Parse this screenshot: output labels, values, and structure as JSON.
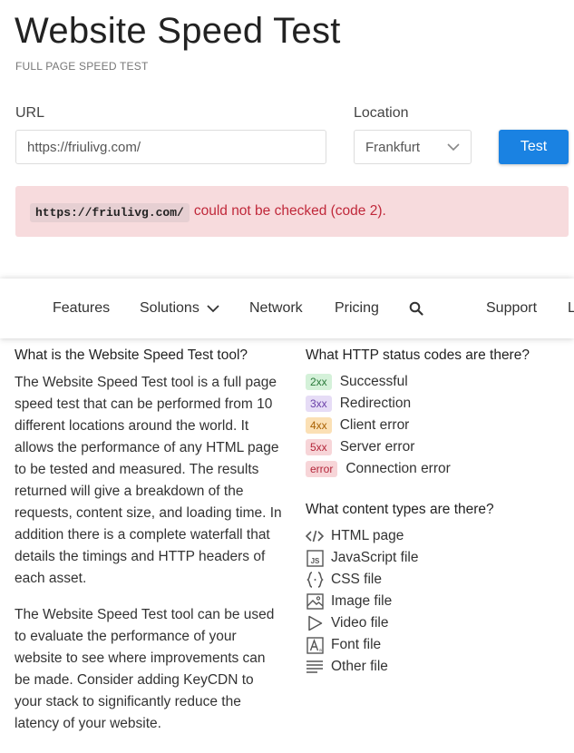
{
  "header": {
    "title": "Website Speed Test",
    "subtitle": "FULL PAGE SPEED TEST"
  },
  "form": {
    "url_label": "URL",
    "url_value": "https://friulivg.com/",
    "location_label": "Location",
    "location_value": "Frankfurt",
    "test_button": "Test"
  },
  "alert": {
    "url": "https://friulivg.com/",
    "message": "could not be checked (code 2)."
  },
  "nav": {
    "items": [
      "Features",
      "Solutions",
      "Network",
      "Pricing",
      "Support",
      "L"
    ]
  },
  "about": {
    "heading": "What is the Website Speed Test tool?",
    "paragraph1": "The Website Speed Test tool is a full page speed test that can be performed from 10 different locations around the world. It allows the performance of any HTML page to be tested and measured. The results returned will give a breakdown of the requests, content size, and loading time. In addition there is a complete waterfall that details the timings and HTTP headers of each asset.",
    "paragraph2": "The Website Speed Test tool can be used to evaluate the performance of your website to see where improvements can be made. Consider adding KeyCDN to your stack to significantly reduce the latency of your website."
  },
  "status_codes": {
    "heading": "What HTTP status codes are there?",
    "items": [
      {
        "badge": "2xx",
        "label": "Successful",
        "bg": "#d4f1d9",
        "fg": "#2a7a3b"
      },
      {
        "badge": "3xx",
        "label": "Redirection",
        "bg": "#e6dcf6",
        "fg": "#6a3fa8"
      },
      {
        "badge": "4xx",
        "label": "Client error",
        "bg": "#fbe0b5",
        "fg": "#a85f00"
      },
      {
        "badge": "5xx",
        "label": "Server error",
        "bg": "#f7d5d8",
        "fg": "#b3263a"
      },
      {
        "badge": "error",
        "label": "Connection error",
        "bg": "#f7d5d8",
        "fg": "#b3263a"
      }
    ]
  },
  "content_types": {
    "heading": "What content types are there?",
    "items": [
      {
        "icon": "html-icon",
        "label": "HTML page"
      },
      {
        "icon": "javascript-file-icon",
        "label": "JavaScript file"
      },
      {
        "icon": "css-file-icon",
        "label": "CSS file"
      },
      {
        "icon": "image-file-icon",
        "label": "Image file"
      },
      {
        "icon": "video-file-icon",
        "label": "Video file"
      },
      {
        "icon": "font-file-icon",
        "label": "Font file"
      },
      {
        "icon": "other-file-icon",
        "label": "Other file"
      }
    ]
  },
  "colors": {
    "accent": "#1a82e2",
    "alert_bg": "#f7dbdd",
    "alert_text": "#c0283a"
  }
}
